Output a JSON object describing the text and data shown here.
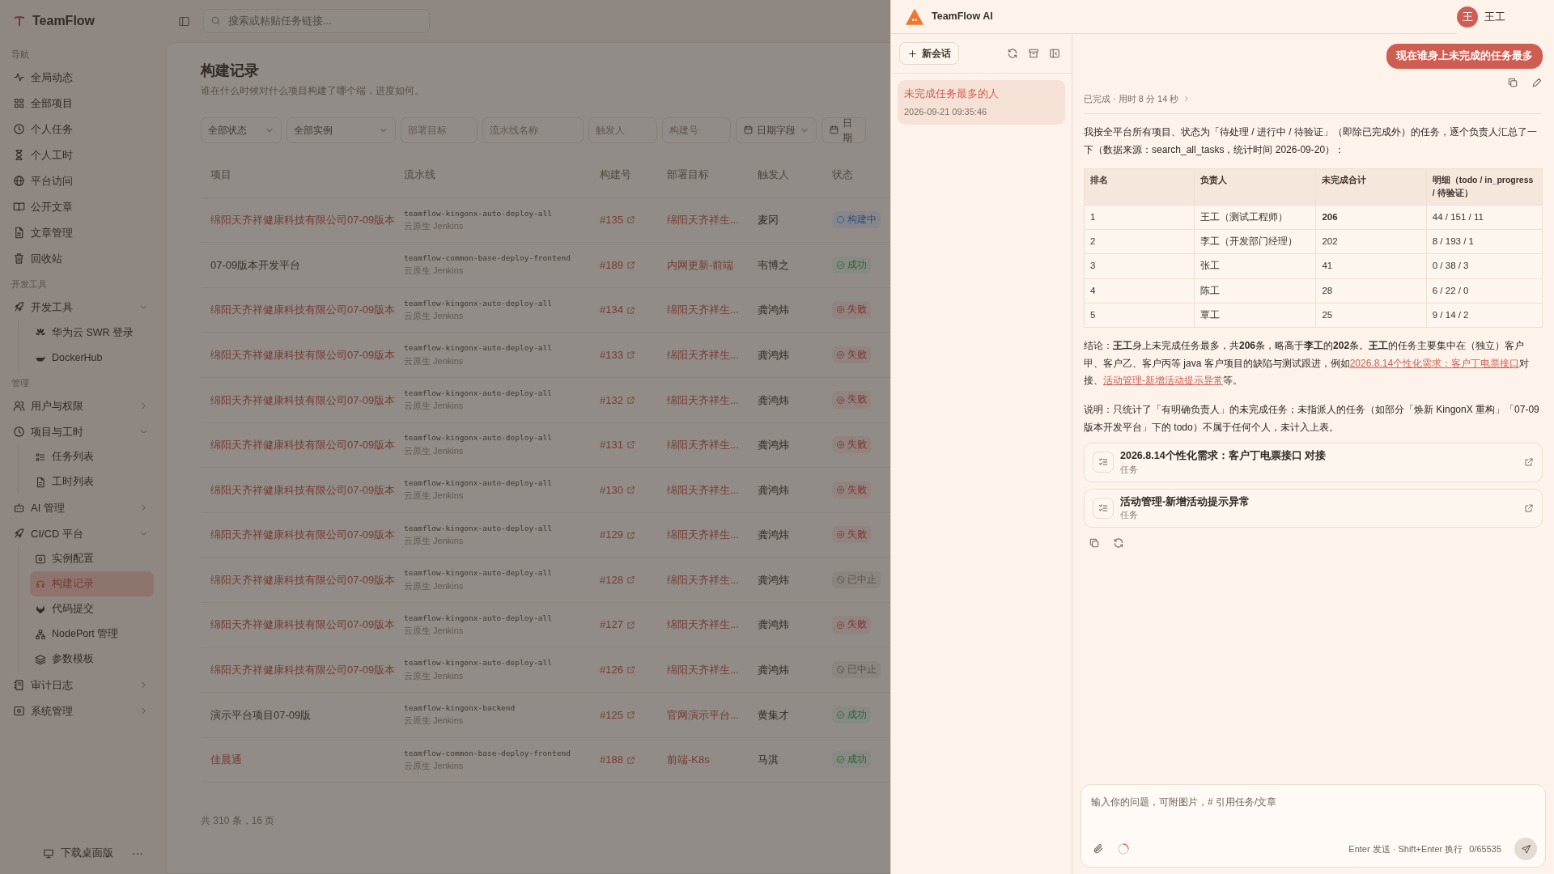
{
  "app": {
    "brand": "TeamFlow",
    "search": {
      "placeholder": "搜索或粘贴任务链接..."
    }
  },
  "sidebar": {
    "sections": [
      {
        "label": "导航",
        "items": [
          {
            "label": "全局动态",
            "selected": false
          },
          {
            "label": "全部项目",
            "selected": false
          },
          {
            "label": "个人任务",
            "selected": false
          },
          {
            "label": "个人工时",
            "selected": false
          },
          {
            "label": "平台访问",
            "selected": false
          },
          {
            "label": "公开文章",
            "selected": false
          },
          {
            "label": "文章管理",
            "selected": false
          },
          {
            "label": "回收站",
            "selected": false
          }
        ]
      },
      {
        "label": "开发工具",
        "items": [
          {
            "label": "开发工具",
            "selected": false,
            "expanded": true,
            "children": [
              {
                "label": "华为云 SWR 登录",
                "selected": false
              },
              {
                "label": "DockerHub",
                "selected": false
              }
            ]
          }
        ]
      },
      {
        "label": "管理",
        "items": [
          {
            "label": "用户与权限",
            "selected": false,
            "expanded": false
          },
          {
            "label": "项目与工时",
            "selected": false,
            "expanded": true,
            "children": [
              {
                "label": "任务列表",
                "selected": false
              },
              {
                "label": "工时列表",
                "selected": false
              }
            ]
          },
          {
            "label": "AI 管理",
            "selected": false,
            "expanded": false
          },
          {
            "label": "CI/CD 平台",
            "selected": false,
            "expanded": true,
            "children": [
              {
                "label": "实例配置",
                "selected": false
              },
              {
                "label": "构建记录",
                "selected": true
              },
              {
                "label": "代码提交",
                "selected": false
              },
              {
                "label": "NodePort 管理",
                "selected": false
              },
              {
                "label": "参数模板",
                "selected": false
              }
            ]
          },
          {
            "label": "审计日志",
            "selected": false,
            "expanded": false
          },
          {
            "label": "系统管理",
            "selected": false,
            "expanded": false
          }
        ]
      }
    ],
    "footer": {
      "download": "下载桌面版",
      "more": "···"
    }
  },
  "page": {
    "title": "构建记录",
    "subtitle": "谁在什么时候对什么项目构建了哪个端，进度如何。",
    "filters": [
      {
        "kind": "select",
        "label": "全部状态"
      },
      {
        "kind": "select",
        "label": "全部实例"
      },
      {
        "kind": "input",
        "placeholder": "部署目标"
      },
      {
        "kind": "input",
        "placeholder": "流水线名称"
      },
      {
        "kind": "input",
        "placeholder": "触发人"
      },
      {
        "kind": "input",
        "placeholder": "构建号"
      },
      {
        "kind": "date-select",
        "label": "日期字段"
      },
      {
        "kind": "date",
        "placeholder": "日期"
      }
    ],
    "table": {
      "columns": [
        "项目",
        "流水线",
        "构建号",
        "部署目标",
        "触发人",
        "状态"
      ],
      "rows": [
        {
          "project": "绵阳天齐祥健康科技有限公司07-09版本",
          "linked": true,
          "pipeline": "teamflow-kingonx-auto-deploy-all",
          "engine": "云原生 Jenkins",
          "build": "#135",
          "target": "绵阳天齐祥生...",
          "trigger": "麦冈",
          "status": {
            "kind": "running",
            "label": "构建中"
          }
        },
        {
          "project": "07-09版本开发平台",
          "linked": false,
          "pipeline": "teamflow-common-base-deploy-frontend",
          "engine": "云原生 Jenkins",
          "build": "#189",
          "target": "内网更新-前端",
          "trigger": "韦博之",
          "status": {
            "kind": "success",
            "label": "成功"
          }
        },
        {
          "project": "绵阳天齐祥健康科技有限公司07-09版本",
          "linked": true,
          "pipeline": "teamflow-kingonx-auto-deploy-all",
          "engine": "云原生 Jenkins",
          "build": "#134",
          "target": "绵阳天齐祥生...",
          "trigger": "龚鸿炜",
          "status": {
            "kind": "failed",
            "label": "失败"
          }
        },
        {
          "project": "绵阳天齐祥健康科技有限公司07-09版本",
          "linked": true,
          "pipeline": "teamflow-kingonx-auto-deploy-all",
          "engine": "云原生 Jenkins",
          "build": "#133",
          "target": "绵阳天齐祥生...",
          "trigger": "龚鸿炜",
          "status": {
            "kind": "failed",
            "label": "失败"
          }
        },
        {
          "project": "绵阳天齐祥健康科技有限公司07-09版本",
          "linked": true,
          "pipeline": "teamflow-kingonx-auto-deploy-all",
          "engine": "云原生 Jenkins",
          "build": "#132",
          "target": "绵阳天齐祥生...",
          "trigger": "龚鸿炜",
          "status": {
            "kind": "failed",
            "label": "失败"
          }
        },
        {
          "project": "绵阳天齐祥健康科技有限公司07-09版本",
          "linked": true,
          "pipeline": "teamflow-kingonx-auto-deploy-all",
          "engine": "云原生 Jenkins",
          "build": "#131",
          "target": "绵阳天齐祥生...",
          "trigger": "龚鸿炜",
          "status": {
            "kind": "failed",
            "label": "失败"
          }
        },
        {
          "project": "绵阳天齐祥健康科技有限公司07-09版本",
          "linked": true,
          "pipeline": "teamflow-kingonx-auto-deploy-all",
          "engine": "云原生 Jenkins",
          "build": "#130",
          "target": "绵阳天齐祥生...",
          "trigger": "龚鸿炜",
          "status": {
            "kind": "failed",
            "label": "失败"
          }
        },
        {
          "project": "绵阳天齐祥健康科技有限公司07-09版本",
          "linked": true,
          "pipeline": "teamflow-kingonx-auto-deploy-all",
          "engine": "云原生 Jenkins",
          "build": "#129",
          "target": "绵阳天齐祥生...",
          "trigger": "龚鸿炜",
          "status": {
            "kind": "failed",
            "label": "失败"
          }
        },
        {
          "project": "绵阳天齐祥健康科技有限公司07-09版本",
          "linked": true,
          "pipeline": "teamflow-kingonx-auto-deploy-all",
          "engine": "云原生 Jenkins",
          "build": "#128",
          "target": "绵阳天齐祥生...",
          "trigger": "龚鸿炜",
          "status": {
            "kind": "aborted",
            "label": "已中止"
          }
        },
        {
          "project": "绵阳天齐祥健康科技有限公司07-09版本",
          "linked": true,
          "pipeline": "teamflow-kingonx-auto-deploy-all",
          "engine": "云原生 Jenkins",
          "build": "#127",
          "target": "绵阳天齐祥生...",
          "trigger": "龚鸿炜",
          "status": {
            "kind": "failed",
            "label": "失败"
          }
        },
        {
          "project": "绵阳天齐祥健康科技有限公司07-09版本",
          "linked": true,
          "pipeline": "teamflow-kingonx-auto-deploy-all",
          "engine": "云原生 Jenkins",
          "build": "#126",
          "target": "绵阳天齐祥生...",
          "trigger": "龚鸿炜",
          "status": {
            "kind": "aborted",
            "label": "已中止"
          }
        },
        {
          "project": "演示平台项目07-09版",
          "linked": false,
          "pipeline": "teamflow-kingonx-backend",
          "engine": "云原生 Jenkins",
          "build": "#125",
          "target": "官网演示平台...",
          "trigger": "黄集才",
          "status": {
            "kind": "success",
            "label": "成功"
          }
        },
        {
          "project": "佳晨通",
          "linked": true,
          "pipeline": "teamflow-common-base-deploy-frontend",
          "engine": "云原生 Jenkins",
          "build": "#188",
          "target": "前端-K8s",
          "trigger": "马淇",
          "status": {
            "kind": "success",
            "label": "成功"
          }
        }
      ]
    },
    "footer": "共 310 条，16 页"
  },
  "assistant": {
    "title": "TeamFlow AI",
    "user": {
      "avatar": "王",
      "name": "王工"
    },
    "new_chat": "新会话",
    "conversations": [
      {
        "title": "未完成任务最多的人",
        "time": "2026-09-21 09:35:46",
        "selected": true
      }
    ],
    "question": "现在谁身上未完成的任务最多",
    "answer": {
      "status": "已完成 · 用时 8 分 14 秒",
      "intro": "我按全平台所有项目、状态为「待处理 / 进行中 / 待验证」（即除已完成外）的任务，逐个负责人汇总了一下（数据来源：search_all_tasks，统计时间 2026-09-20）：",
      "table": {
        "columns": [
          "排名",
          "负责人",
          "未完成合计",
          "明细（todo / in_progress / 待验证）"
        ],
        "rows": [
          [
            "1",
            "王工（测试工程师）",
            "**206**",
            "44 / 151 / 11"
          ],
          [
            "2",
            "李工（开发部门经理）",
            "202",
            "8 / 193 / 1"
          ],
          [
            "3",
            "张工",
            "41",
            "0 / 38 / 3"
          ],
          [
            "4",
            "陈工",
            "28",
            "6 / 22 / 0"
          ],
          [
            "5",
            "覃工",
            "25",
            "9 / 14 / 2"
          ]
        ]
      },
      "conclusion": [
        {
          "kind": "text",
          "text": "结论：**王工**身上未完成任务最多，共**206**条，略高于**李工**的**202**条。**王工**的任务主要集中在（独立）客户甲、客户乙、客户丙等 java 客户项目的缺陷与测试跟进，例如"
        },
        {
          "kind": "link",
          "text": "2026.8.14个性化需求：客户丁电票接口"
        },
        {
          "kind": "text",
          "text": "对接、"
        },
        {
          "kind": "link",
          "text": "活动管理-新增活动提示异常"
        },
        {
          "kind": "text",
          "text": "等。"
        }
      ],
      "note": "说明：只统计了「有明确负责人」的未完成任务；未指派人的任务（如部分「焕新 KingonX 重构」「07-09版本开发平台」下的 todo）不属于任何个人，未计入上表。",
      "refs": [
        {
          "title": "2026.8.14个性化需求：客户丁电票接口 对接",
          "type": "任务"
        },
        {
          "title": "活动管理-新增活动提示异常",
          "type": "任务"
        }
      ]
    },
    "composer": {
      "placeholder": "输入你的问题，可附图片，# 引用任务/文章",
      "hint": "Enter 发送 · Shift+Enter 换行",
      "count": "0/65535"
    }
  }
}
